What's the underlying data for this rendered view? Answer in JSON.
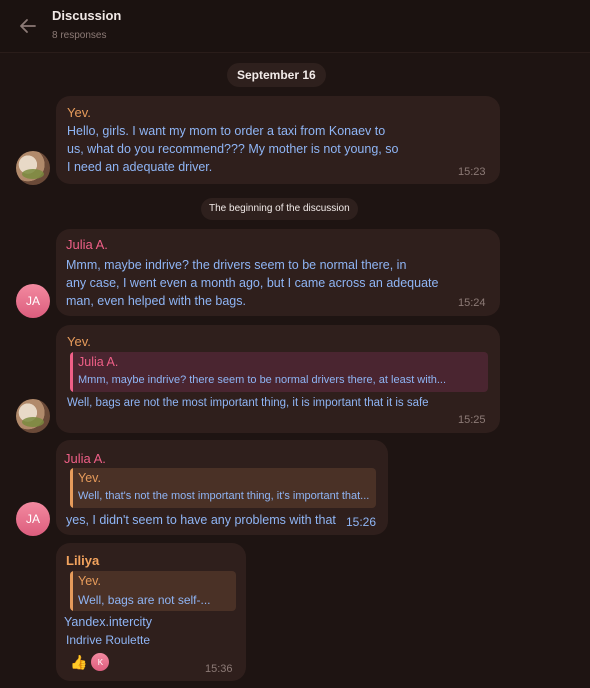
{
  "header": {
    "title": "Discussion",
    "subtitle": "8 responses"
  },
  "date_chip": "September 16",
  "system_message": "The beginning of the discussion",
  "colors": {
    "background": "#1e1412",
    "bubble": "#2f1f1c",
    "text_blue": "#8fb5f5",
    "yev_orange": "#e69b5b",
    "julia_pink": "#ef5f87",
    "liliya_orange": "#f2a35e"
  },
  "messages": [
    {
      "sender": "Yev.",
      "lines": [
        "Hello, girls. I want my mom to order a taxi from Konaev to",
        "us, what do you recommend??? My mother is not young, so",
        "I need an adequate driver."
      ],
      "time": "15:23",
      "avatar": "photo"
    },
    {
      "sender": "Julia A.",
      "lines": [
        "Mmm, maybe indrive? the drivers seem to be normal there, in",
        "any case, I went even a month ago, but I came across an adequate",
        "man, even helped with the bags."
      ],
      "time": "15:24",
      "avatar": "JA"
    },
    {
      "sender": "Yev.",
      "quote": {
        "author": "Julia A.",
        "text": "Mmm, maybe indrive? there seem to be normal drivers there, at least with..."
      },
      "lines": [
        "Well, bags are not the most important thing, it is important that it is safe"
      ],
      "time": "15:25",
      "avatar": "photo"
    },
    {
      "sender": "Julia A.",
      "quote": {
        "author": "Yev.",
        "text": "Well, that's not the most important thing, it's important that..."
      },
      "lines": [
        "yes, I didn't seem to have any problems with that"
      ],
      "time": "15:26",
      "avatar": "JA"
    },
    {
      "sender": "Liliya",
      "quote": {
        "author": "Yev.",
        "text": "Well, bags are not self-..."
      },
      "lines": [
        "Yandex.intercity",
        "Indrive Roulette"
      ],
      "time": "15:36",
      "reaction": {
        "emoji": "👍",
        "reactor_initial": "K"
      }
    }
  ]
}
